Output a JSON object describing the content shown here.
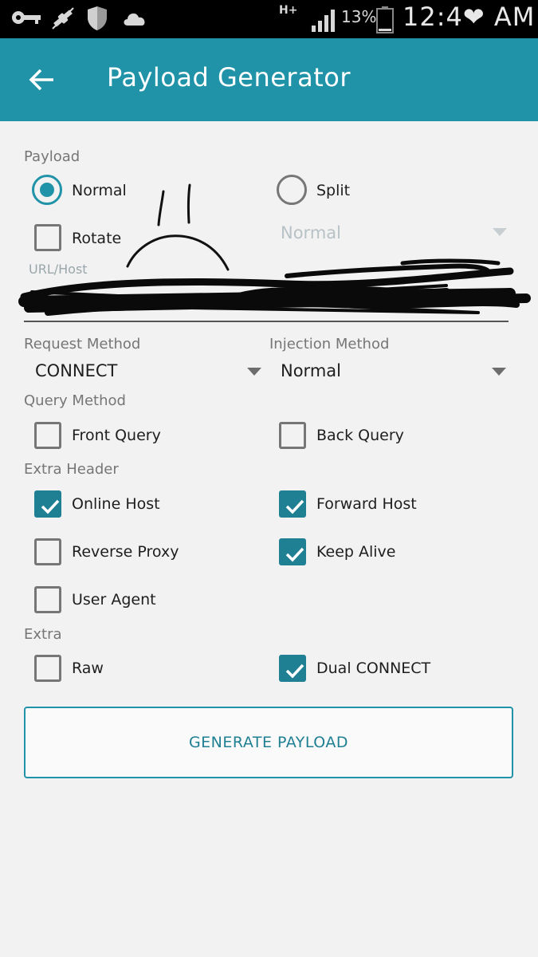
{
  "status_bar": {
    "network": "H+",
    "battery_percent": "13%",
    "time": "12:4❤ AM",
    "icons": [
      "key-icon",
      "satellite-icon",
      "shield-icon",
      "cloud-icon",
      "signal-icon",
      "battery-icon"
    ]
  },
  "app_bar": {
    "title": "Payload Generator",
    "back_icon": "arrow-left-icon"
  },
  "payload": {
    "section_label": "Payload",
    "normal_label": "Normal",
    "split_label": "Split",
    "rotate_label": "Rotate",
    "split_mode_value": "Normal"
  },
  "url_host": {
    "label": "URL/Host",
    "value_redacted": true
  },
  "request_method": {
    "label": "Request Method",
    "value": "CONNECT"
  },
  "injection_method": {
    "label": "Injection Method",
    "value": "Normal"
  },
  "query_method": {
    "label": "Query Method",
    "front_label": "Front Query",
    "back_label": "Back Query"
  },
  "extra_header": {
    "label": "Extra Header",
    "online_host": "Online Host",
    "forward_host": "Forward Host",
    "reverse_proxy": "Reverse Proxy",
    "keep_alive": "Keep Alive",
    "user_agent": "User Agent"
  },
  "extra": {
    "label": "Extra",
    "raw": "Raw",
    "dual_connect": "Dual CONNECT"
  },
  "generate_button": "GENERATE PAYLOAD",
  "colors": {
    "accent": "#2193a8",
    "check_fill": "#1f7f93",
    "background": "#f2f2f2",
    "status_bar": "#000000"
  },
  "state": {
    "payload_mode": "Normal",
    "rotate": false,
    "front_query": false,
    "back_query": false,
    "online_host": true,
    "forward_host": true,
    "reverse_proxy": false,
    "keep_alive": true,
    "user_agent": false,
    "raw": false,
    "dual_connect": true
  }
}
